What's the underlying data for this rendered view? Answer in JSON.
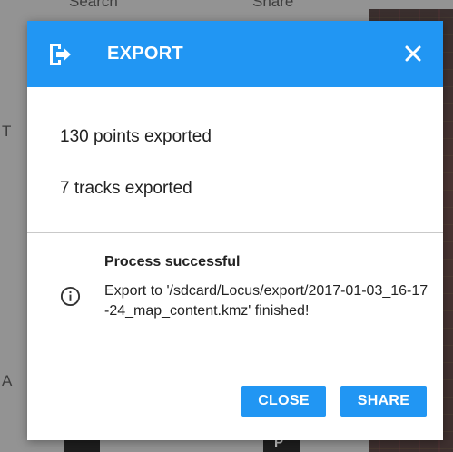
{
  "background": {
    "top_left_label": "Search",
    "top_right_label": "Share",
    "left_letter_1": "T",
    "left_letter_2": "A",
    "bottom_right_label": "P"
  },
  "dialog": {
    "title": "EXPORT",
    "points_line": "130 points exported",
    "tracks_line": "7 tracks exported",
    "message_title": "Process successful",
    "message_text": "Export to '/sdcard/Locus/export/2017-01-03_16-17-24_map_content.kmz' finished!",
    "close_label": "CLOSE",
    "share_label": "SHARE",
    "accent_color": "#2196f3",
    "header_icon": "export-icon",
    "close_icon": "close-icon",
    "info_icon": "info-icon"
  }
}
